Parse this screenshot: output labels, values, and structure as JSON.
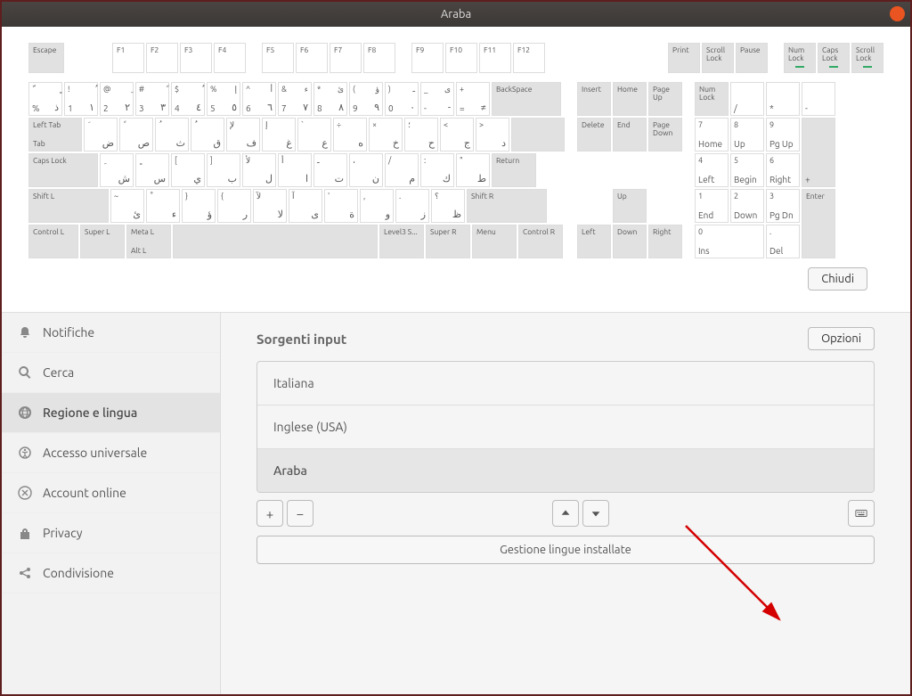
{
  "title": "Araba",
  "keyboard": {
    "escape": "Escape",
    "fkeys": [
      "F1",
      "F2",
      "F3",
      "F4",
      "F5",
      "F6",
      "F7",
      "F8",
      "F9",
      "F10",
      "F11",
      "F12"
    ],
    "nav_top": [
      "Print",
      "Scroll Lock",
      "Pause"
    ],
    "locks": [
      "Num Lock",
      "Caps Lock",
      "Scroll Lock"
    ],
    "backspace": "BackSpace",
    "tab_top": "Left Tab",
    "tab_bot": "Tab",
    "caps": "Caps Lock",
    "return": "Return",
    "shift_l": "Shift L",
    "shift_r": "Shift R",
    "ctrl_l": "Control L",
    "super_l": "Super L",
    "meta_l": "Meta L",
    "alt_l": "Alt L",
    "level3": "Level3 S...",
    "super_r": "Super R",
    "menu": "Menu",
    "ctrl_r": "Control R",
    "ins_blk": [
      "Insert",
      "Home",
      "Page Up",
      "Delete",
      "End",
      "Page Down"
    ],
    "arrows": [
      "Up",
      "Left",
      "Down",
      "Right"
    ],
    "numlock": "Num Lock",
    "np_ops": [
      "/",
      "*",
      "-",
      "+"
    ],
    "np_nums": [
      [
        "7",
        "Home"
      ],
      [
        "8",
        "Up"
      ],
      [
        "9",
        "Pg Up"
      ],
      [
        "4",
        "Left"
      ],
      [
        "5",
        "Begin"
      ],
      [
        "6",
        "Right"
      ],
      [
        "1",
        "End"
      ],
      [
        "2",
        "Down"
      ],
      [
        "3",
        "Pg Dn"
      ],
      [
        "0",
        "Ins"
      ],
      [
        ".",
        "Del"
      ]
    ],
    "enter": "Enter",
    "row1": [
      [
        "ّ",
        "ذ",
        "%",
        "ٍ"
      ],
      [
        "!",
        "١",
        "1",
        "ُ"
      ],
      [
        "@",
        "٢",
        "2",
        "ِ"
      ],
      [
        "#",
        "٣",
        "3",
        "ً"
      ],
      [
        "$",
        "٤",
        "4",
        "ٌ"
      ],
      [
        "%",
        "٥",
        "5",
        "إ"
      ],
      [
        "^",
        "٦",
        "6",
        "أ"
      ],
      [
        "&",
        "٧",
        "7",
        "ء"
      ],
      [
        "*",
        "٨",
        "8",
        "ئ"
      ],
      [
        "(",
        "٩",
        "9",
        "ؤ"
      ],
      [
        ")",
        "٠",
        "0",
        "ـ"
      ],
      [
        "_",
        "-",
        "-",
        "ى"
      ],
      [
        "+",
        "≠",
        "=",
        ""
      ]
    ],
    "row2": [
      [
        "َ",
        "ض"
      ],
      [
        "ً",
        "ص"
      ],
      [
        "ُ",
        "ث"
      ],
      [
        "ٌ",
        "ق"
      ],
      [
        "لإ",
        "ف"
      ],
      [
        "إ",
        "غ"
      ],
      [
        "`",
        "ع"
      ],
      [
        "÷",
        "ه"
      ],
      [
        "×",
        "خ"
      ],
      [
        "؛",
        "ح"
      ],
      [
        "<",
        "ج"
      ],
      [
        ">",
        "د"
      ]
    ],
    "row3": [
      [
        "ِ",
        "ش"
      ],
      [
        "ٍ",
        "س"
      ],
      [
        "[",
        "ي"
      ],
      [
        "]",
        "ب"
      ],
      [
        "لأ",
        "ل"
      ],
      [
        "أ",
        "ا"
      ],
      [
        "ـ",
        "ت"
      ],
      [
        "،",
        "ن"
      ],
      [
        "/",
        "م"
      ],
      [
        ":",
        "ك"
      ],
      [
        "\"",
        "ط"
      ]
    ],
    "row4": [
      [
        "~",
        "ئ"
      ],
      [
        "ْ",
        "ء"
      ],
      [
        "}",
        "ؤ"
      ],
      [
        "{",
        "ر"
      ],
      [
        "لآ",
        "لا"
      ],
      [
        "آ",
        "ى"
      ],
      [
        "'",
        "ة"
      ],
      [
        ",",
        "و"
      ],
      [
        ".",
        "ز"
      ],
      [
        "؟",
        "ظ"
      ]
    ]
  },
  "close_btn": "Chiudi",
  "sidebar": [
    {
      "icon": "bell",
      "label": "Notifiche"
    },
    {
      "icon": "search",
      "label": "Cerca"
    },
    {
      "icon": "globe",
      "label": "Regione e lingua",
      "active": true
    },
    {
      "icon": "access",
      "label": "Accesso universale"
    },
    {
      "icon": "online",
      "label": "Account online"
    },
    {
      "icon": "privacy",
      "label": "Privacy"
    },
    {
      "icon": "share",
      "label": "Condivisione"
    }
  ],
  "content": {
    "heading": "Sorgenti input",
    "options": "Opzioni",
    "sources": [
      "Italiana",
      "Inglese (USA)",
      "Araba"
    ],
    "selected": 2,
    "manage": "Gestione lingue installate"
  }
}
